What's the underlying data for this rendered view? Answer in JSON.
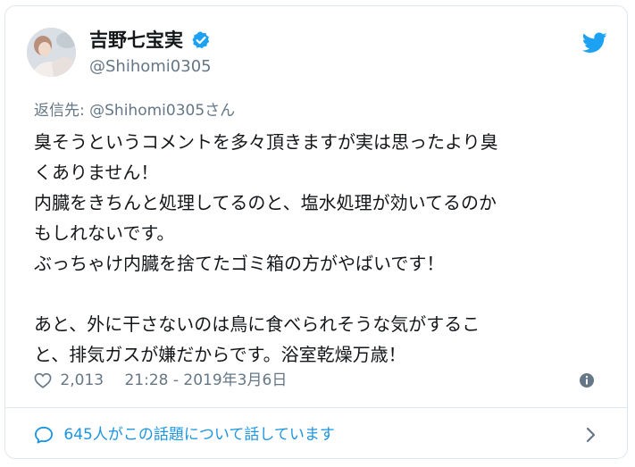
{
  "author": {
    "display_name": "吉野七宝実",
    "handle": "@Shihomi0305",
    "verified": true,
    "avatar_icon": "profile-photo"
  },
  "reply_to": "返信先: @Shihomi0305さん",
  "tweet": {
    "lines": [
      "臭そうというコメントを多々頂きますが実は思ったより臭",
      "くありません！",
      "内臓をきちんと処理してるのと、塩水処理が効いてるのか",
      "もしれないです。",
      "ぶっちゃけ内臓を捨てたゴミ箱の方がやばいです！",
      "",
      "あと、外に干さないのは鳥に食べられそうな気がするこ",
      "と、排気ガスが嫌だからです。浴室乾燥万歳！"
    ]
  },
  "meta": {
    "likes": "2,013",
    "timestamp": "21:28 - 2019年3月6日"
  },
  "conversation": {
    "label": "645人がこの話題について話しています"
  },
  "icons": {
    "brand": "twitter-bird-icon",
    "verified": "verified-badge-icon",
    "like": "heart-icon",
    "info": "info-icon",
    "reply": "speech-bubble-icon",
    "chevron": "chevron-right-icon"
  },
  "colors": {
    "accent": "#1da1f2",
    "link": "#1b95e0",
    "text": "#14171a",
    "muted": "#657786",
    "border": "#e1e8ed"
  }
}
